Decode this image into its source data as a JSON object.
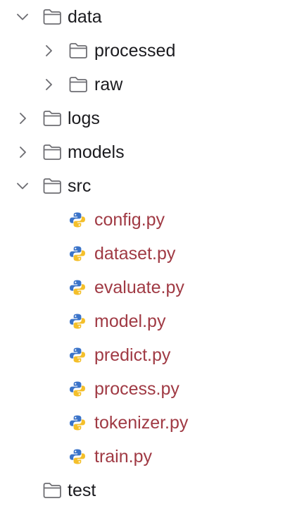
{
  "file_tree": {
    "items": [
      {
        "label": "data",
        "type": "folder",
        "depth": 0,
        "expanded": true
      },
      {
        "label": "processed",
        "type": "folder",
        "depth": 1,
        "expanded": false
      },
      {
        "label": "raw",
        "type": "folder",
        "depth": 1,
        "expanded": false
      },
      {
        "label": "logs",
        "type": "folder",
        "depth": 0,
        "expanded": false
      },
      {
        "label": "models",
        "type": "folder",
        "depth": 0,
        "expanded": false
      },
      {
        "label": "src",
        "type": "folder",
        "depth": 0,
        "expanded": true
      },
      {
        "label": "config.py",
        "type": "python-file",
        "depth": 1
      },
      {
        "label": "dataset.py",
        "type": "python-file",
        "depth": 1
      },
      {
        "label": "evaluate.py",
        "type": "python-file",
        "depth": 1
      },
      {
        "label": "model.py",
        "type": "python-file",
        "depth": 1
      },
      {
        "label": "predict.py",
        "type": "python-file",
        "depth": 1
      },
      {
        "label": "process.py",
        "type": "python-file",
        "depth": 1
      },
      {
        "label": "tokenizer.py",
        "type": "python-file",
        "depth": 1
      },
      {
        "label": "train.py",
        "type": "python-file",
        "depth": 1
      },
      {
        "label": "test",
        "type": "folder",
        "depth": 0,
        "expanded": null
      }
    ]
  },
  "icons": {
    "folder": "folder-icon",
    "python_file": "python-file-icon",
    "expanded": "chevron-down-icon",
    "collapsed": "chevron-right-icon"
  },
  "colors": {
    "folder_label": "#1b1b1f",
    "python_label": "#a03a44",
    "chevron": "#6e6e73",
    "folder_outline": "#6e6e73",
    "python_blue": "#3a73c9",
    "python_yellow": "#f4bf2a"
  }
}
